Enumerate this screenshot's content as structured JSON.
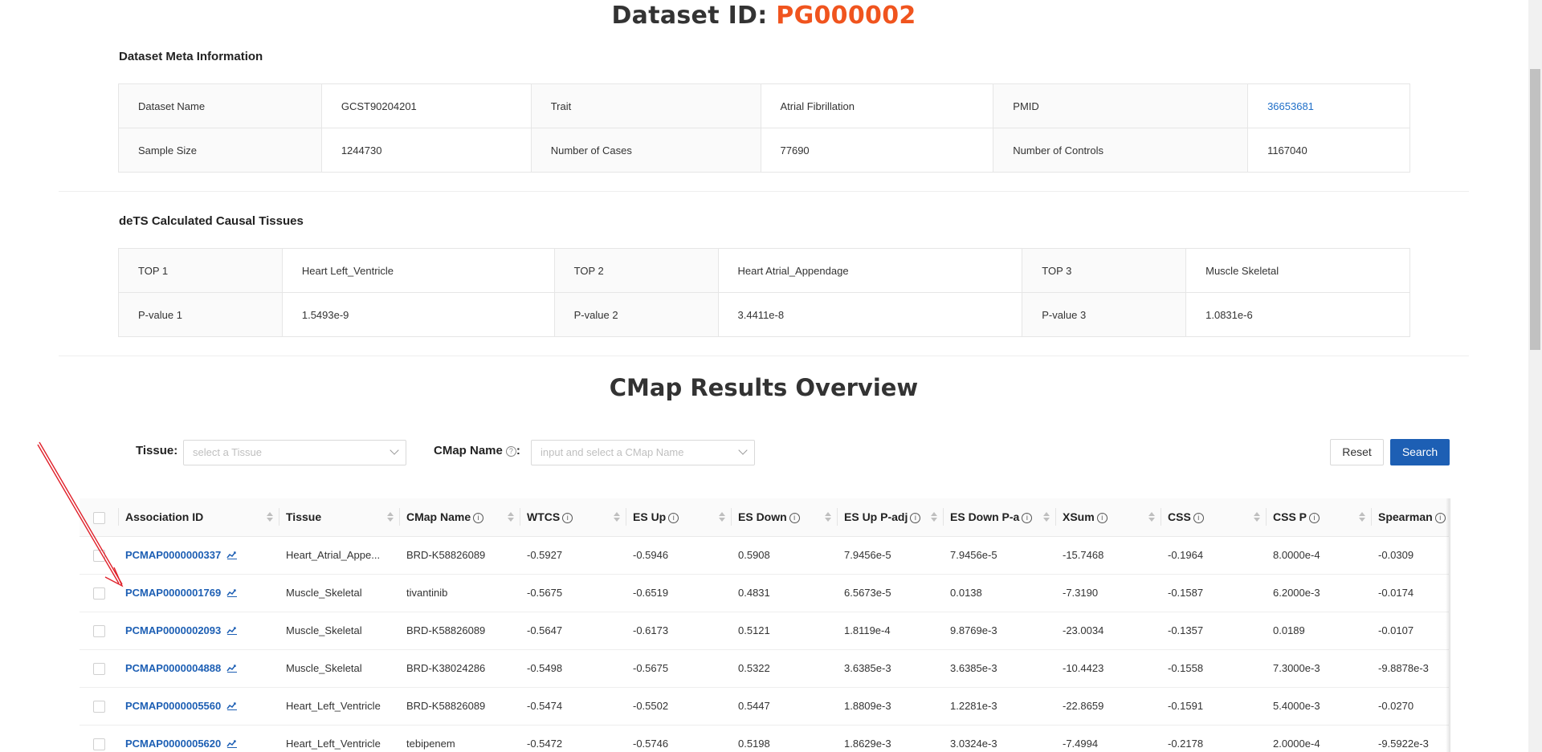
{
  "header": {
    "title_prefix": "Dataset ID: ",
    "dataset_id": "PG000002",
    "accent_color": "#f0541e"
  },
  "meta": {
    "heading": "Dataset Meta Information",
    "rows": [
      [
        {
          "label": "Dataset Name",
          "value": "GCST90204201"
        },
        {
          "label": "Trait",
          "value": "Atrial Fibrillation"
        },
        {
          "label": "PMID",
          "value": "36653681"
        }
      ],
      [
        {
          "label": "Sample Size",
          "value": "1244730"
        },
        {
          "label": "Number of Cases",
          "value": "77690"
        },
        {
          "label": "Number of Controls",
          "value": "1167040"
        }
      ]
    ]
  },
  "tissues": {
    "heading": "deTS Calculated Causal Tissues",
    "rows": [
      [
        {
          "label": "TOP 1",
          "value": "Heart Left_Ventricle"
        },
        {
          "label": "TOP 2",
          "value": "Heart Atrial_Appendage"
        },
        {
          "label": "TOP 3",
          "value": "Muscle Skeletal"
        }
      ],
      [
        {
          "label": "P-value 1",
          "value": "1.5493e-9"
        },
        {
          "label": "P-value 2",
          "value": "3.4411e-8"
        },
        {
          "label": "P-value 3",
          "value": "1.0831e-6"
        }
      ]
    ]
  },
  "overview": {
    "title": "CMap Results Overview",
    "filters": {
      "tissue_label": "Tissue",
      "tissue_placeholder": "select a Tissue",
      "cmap_label": "CMap Name",
      "cmap_placeholder": "input and select a CMap Name",
      "reset_label": "Reset",
      "search_label": "Search"
    },
    "columns": [
      {
        "label": "Association ID",
        "info": false
      },
      {
        "label": "Tissue",
        "info": false
      },
      {
        "label": "CMap Name",
        "info": true
      },
      {
        "label": "WTCS",
        "info": true
      },
      {
        "label": "ES Up",
        "info": true
      },
      {
        "label": "ES Down",
        "info": true
      },
      {
        "label": "ES Up P-adj",
        "info": true
      },
      {
        "label": "ES Down P-a",
        "info": true
      },
      {
        "label": "XSum",
        "info": true
      },
      {
        "label": "CSS",
        "info": true
      },
      {
        "label": "CSS P",
        "info": true
      },
      {
        "label": "Spearman",
        "info": true
      }
    ],
    "rows": [
      [
        "PCMAP0000000337",
        "Heart_Atrial_Appe...",
        "BRD-K58826089",
        "-0.5927",
        "-0.5946",
        "0.5908",
        "7.9456e-5",
        "7.9456e-5",
        "-15.7468",
        "-0.1964",
        "8.0000e-4",
        "-0.0309"
      ],
      [
        "PCMAP0000001769",
        "Muscle_Skeletal",
        "tivantinib",
        "-0.5675",
        "-0.6519",
        "0.4831",
        "6.5673e-5",
        "0.0138",
        "-7.3190",
        "-0.1587",
        "6.2000e-3",
        "-0.0174"
      ],
      [
        "PCMAP0000002093",
        "Muscle_Skeletal",
        "BRD-K58826089",
        "-0.5647",
        "-0.6173",
        "0.5121",
        "1.8119e-4",
        "9.8769e-3",
        "-23.0034",
        "-0.1357",
        "0.0189",
        "-0.0107"
      ],
      [
        "PCMAP0000004888",
        "Muscle_Skeletal",
        "BRD-K38024286",
        "-0.5498",
        "-0.5675",
        "0.5322",
        "3.6385e-3",
        "3.6385e-3",
        "-10.4423",
        "-0.1558",
        "7.3000e-3",
        "-9.8878e-3"
      ],
      [
        "PCMAP0000005560",
        "Heart_Left_Ventricle",
        "BRD-K58826089",
        "-0.5474",
        "-0.5502",
        "0.5447",
        "1.8809e-3",
        "1.2281e-3",
        "-22.8659",
        "-0.1591",
        "5.4000e-3",
        "-0.0270"
      ],
      [
        "PCMAP0000005620",
        "Heart_Left_Ventricle",
        "tebipenem",
        "-0.5472",
        "-0.5746",
        "0.5198",
        "1.8629e-3",
        "3.0324e-3",
        "-7.4994",
        "-0.2178",
        "2.0000e-4",
        "-9.5922e-3"
      ]
    ]
  },
  "colors": {
    "link": "#1d5fb4",
    "primary_button": "#1d5fb4",
    "annotation_arrow": "#e0202a"
  }
}
